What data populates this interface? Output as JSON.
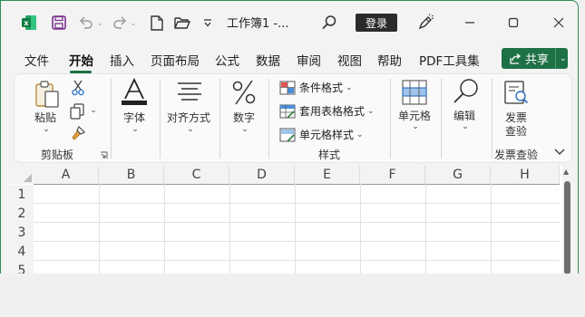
{
  "titlebar": {
    "doc_title": "工作簿1  -...",
    "login_label": "登录",
    "icons": [
      "excel-logo",
      "save-icon",
      "undo-icon",
      "redo-icon",
      "new-file-icon",
      "open-folder-icon",
      "customize-qat-icon",
      "search-icon",
      "pen-icon",
      "minimize-icon",
      "maximize-icon",
      "close-icon"
    ]
  },
  "menu": {
    "tabs": [
      "文件",
      "开始",
      "插入",
      "页面布局",
      "公式",
      "数据",
      "审阅",
      "视图",
      "帮助",
      "PDF工具集"
    ],
    "active_tab": "开始",
    "share_label": "共享"
  },
  "ribbon": {
    "clipboard": {
      "paste_label": "粘贴",
      "group_label": "剪贴板"
    },
    "font": {
      "label": "字体"
    },
    "alignment": {
      "label": "对齐方式"
    },
    "number": {
      "label": "数字"
    },
    "styles": {
      "conditional_format": "条件格式",
      "table_format": "套用表格格式",
      "cell_styles": "单元格样式",
      "group_label": "样式"
    },
    "cells": {
      "label": "单元格"
    },
    "editing": {
      "label": "编辑"
    },
    "invoice": {
      "label_line1": "发票",
      "label_line2": "查验",
      "group_label": "发票查验"
    }
  },
  "sheet": {
    "columns": [
      "A",
      "B",
      "C",
      "D",
      "E",
      "F",
      "G",
      "H"
    ],
    "rows": [
      "1",
      "2",
      "3",
      "4",
      "5"
    ]
  },
  "colors": {
    "accent": "#1e7145",
    "excel_green": "#107c41",
    "window_border": "#2e8b57",
    "login_bg": "#2b2b2b"
  }
}
